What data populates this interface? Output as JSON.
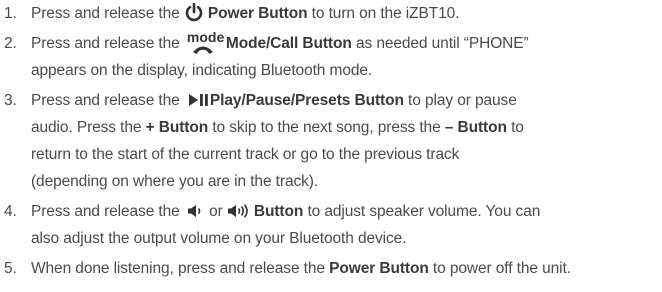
{
  "steps": [
    {
      "number": "1.",
      "lines": [
        {
          "p1": "Press and release the ",
          "icon": "power-icon",
          "bold": "Power Button",
          "p2": " to turn on the iZBT10."
        }
      ]
    },
    {
      "number": "2.",
      "lines": [
        {
          "p1": "Press and release the ",
          "icon_label": "mode",
          "icon": "mode-phone-icon",
          "bold": "Mode/Call Button",
          "p2": " as needed until “PHONE”"
        },
        {
          "p1": "appears on the display, indicating Bluetooth mode."
        }
      ]
    },
    {
      "number": "3.",
      "lines": [
        {
          "p1": "Press and release the ",
          "icon": "play-pause-icon",
          "bold": "Play/Pause/Presets Button",
          "p2": " to play or pause"
        },
        {
          "p1": "audio. Press the ",
          "bold_a": "+ Button",
          "p2": " to skip to the next song, press the ",
          "bold_b": "– Button",
          "p3": " to"
        },
        {
          "p1": "return to the start of the current track or go to the previous track"
        },
        {
          "p1": "(depending on where you are in the track)."
        }
      ]
    },
    {
      "number": "4.",
      "lines": [
        {
          "p1": "Press and release the ",
          "icon_a": "volume-down-icon",
          "or": " or ",
          "icon_b": "volume-up-icon",
          "bold": "Button",
          "p2": " to adjust speaker volume.  You can"
        },
        {
          "p1": "also adjust the output volume on your Bluetooth device."
        }
      ]
    },
    {
      "number": "5.",
      "lines": [
        {
          "p1": "When done listening, press and release the ",
          "bold": "Power Button",
          "p2": " to power off the unit."
        }
      ]
    }
  ]
}
